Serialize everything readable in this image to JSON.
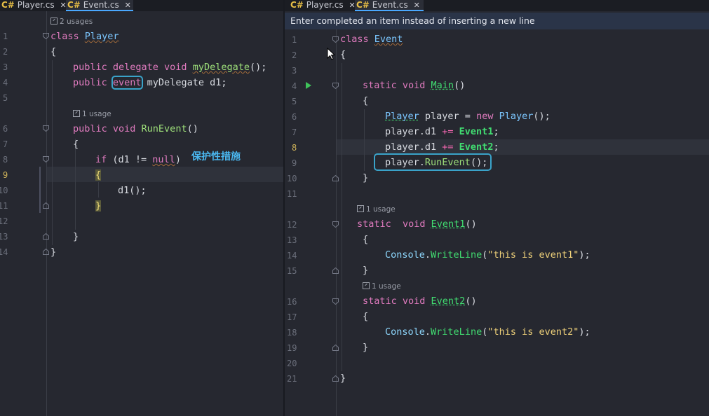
{
  "left": {
    "tabs": [
      {
        "icon": "C#",
        "label": "Player.cs",
        "close": "✕"
      },
      {
        "icon": "C#",
        "label": "Event.cs",
        "close": "✕"
      }
    ],
    "usages": {
      "class": "2 usages",
      "runevent": "1 usage"
    },
    "annotation": "保护性措施",
    "lines": [
      "1",
      "2",
      "3",
      "4",
      "5",
      "6",
      "7",
      "8",
      "9",
      "10",
      "11",
      "12",
      "13",
      "14"
    ],
    "code": {
      "l1_kw": "class ",
      "l1_cls": "Player",
      "l2": "{",
      "l3_kw": "public delegate void ",
      "l3_fn": "myDelegate",
      "l3_rest": "();",
      "l4_kw": "public ",
      "l4_ev": "event",
      "l4_rest": " myDelegate d1;",
      "l6_kw": "public void ",
      "l6_fn": "RunEvent",
      "l6_rest": "()",
      "l7": "{",
      "l8_kw": "if ",
      "l8_a": "(d1 != ",
      "l8_null": "null",
      "l8_b": ")",
      "l9": "{",
      "l10": "d1();",
      "l11": "}",
      "l13": "}",
      "l14": "}"
    }
  },
  "right": {
    "tabs": [
      {
        "icon": "C#",
        "label": "Player.cs",
        "close": "✕"
      },
      {
        "icon": "C#",
        "label": "Event.cs",
        "close": "✕"
      }
    ],
    "hint": "Enter completed an item instead of inserting a new line",
    "usages": {
      "event1": "1 usage",
      "event2": "1 usage"
    },
    "lines": [
      "1",
      "2",
      "3",
      "4",
      "5",
      "6",
      "7",
      "8",
      "9",
      "10",
      "11",
      "12",
      "13",
      "14",
      "15",
      "16",
      "17",
      "18",
      "19",
      "20",
      "21"
    ],
    "code": {
      "l1_kw": "class ",
      "l1_cls": "Event",
      "l2": "{",
      "l4_kw": "static void ",
      "l4_fn": "Main",
      "l4_rest": "()",
      "l5": "{",
      "l6_t": "Player",
      "l6_a": " player = ",
      "l6_kw": "new ",
      "l6_t2": "Player",
      "l6_b": "();",
      "l7_a": "player.d1 ",
      "l7_op": "+=",
      "l7_fn": " Event1",
      "l7_b": ";",
      "l8_a": "player.d1 ",
      "l8_op": "+=",
      "l8_fn": " Event2",
      "l8_b": ";",
      "l9_a": "player.",
      "l9_fn": "RunEvent",
      "l9_b": "();",
      "l10": "}",
      "l12_kw": "static  void ",
      "l12_fn": "Event1",
      "l12_rest": "()",
      "l13": "{",
      "l14_t": "Console",
      "l14_dot": ".",
      "l14_m": "WriteLine",
      "l14_a": "(",
      "l14_s": "\"this is event1\"",
      "l14_b": ");",
      "l15": "}",
      "l16_kw": "static void ",
      "l16_fn": "Event2",
      "l16_rest": "()",
      "l17": "{",
      "l18_t": "Console",
      "l18_dot": ".",
      "l18_m": "WriteLine",
      "l18_a": "(",
      "l18_s": "\"this is event2\"",
      "l18_b": ");",
      "l19": "}",
      "l21": "}"
    }
  }
}
